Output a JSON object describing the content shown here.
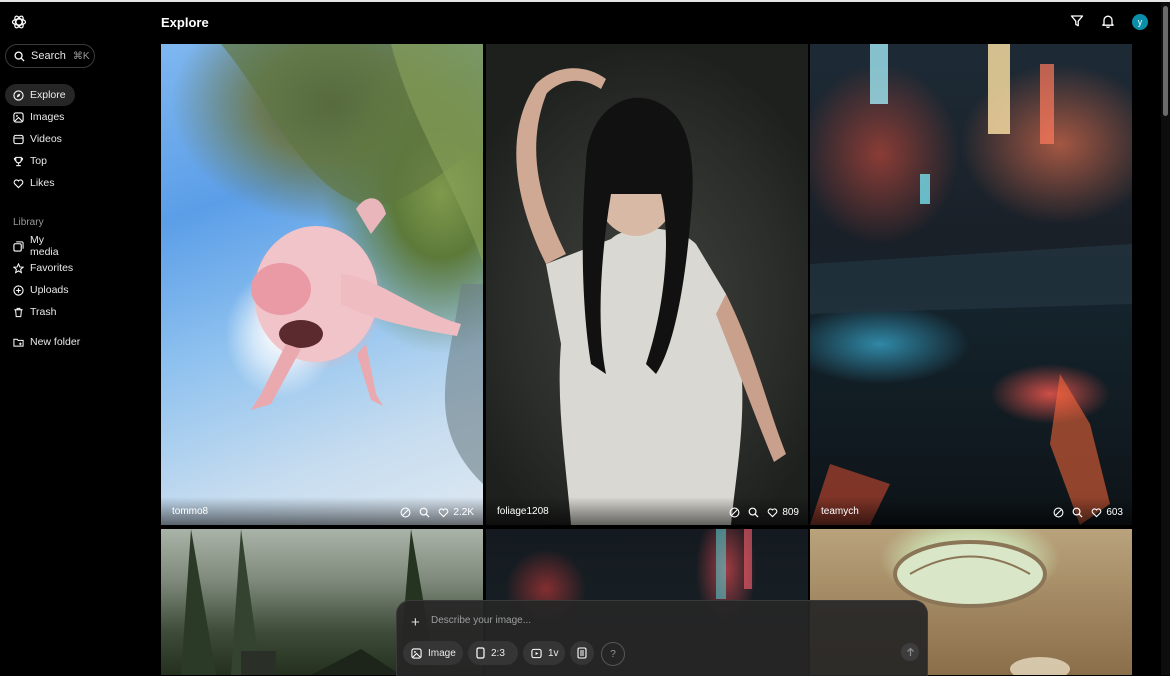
{
  "header": {
    "title": "Explore",
    "avatar_letter": "y"
  },
  "sidebar": {
    "search_label": "Search",
    "search_shortcut": "⌘K",
    "items": [
      {
        "label": "Explore",
        "icon": "compass-icon",
        "active": true
      },
      {
        "label": "Images",
        "icon": "image-icon"
      },
      {
        "label": "Videos",
        "icon": "video-icon"
      },
      {
        "label": "Top",
        "icon": "trophy-icon"
      },
      {
        "label": "Likes",
        "icon": "heart-icon"
      }
    ],
    "library_label": "Library",
    "library_items": [
      {
        "label": "My media",
        "icon": "media-icon"
      },
      {
        "label": "Favorites",
        "icon": "star-icon"
      },
      {
        "label": "Uploads",
        "icon": "upload-icon"
      },
      {
        "label": "Trash",
        "icon": "trash-icon"
      }
    ],
    "new_folder_label": "New folder"
  },
  "feed": [
    {
      "author": "tommo8",
      "likes": "2.2K"
    },
    {
      "author": "foliage1208",
      "likes": "809"
    },
    {
      "author": "teamych",
      "likes": "603"
    }
  ],
  "composer": {
    "placeholder": "Describe your image...",
    "type_label": "Image",
    "aspect_label": "2:3",
    "variants_label": "1v",
    "help_label": "?"
  }
}
